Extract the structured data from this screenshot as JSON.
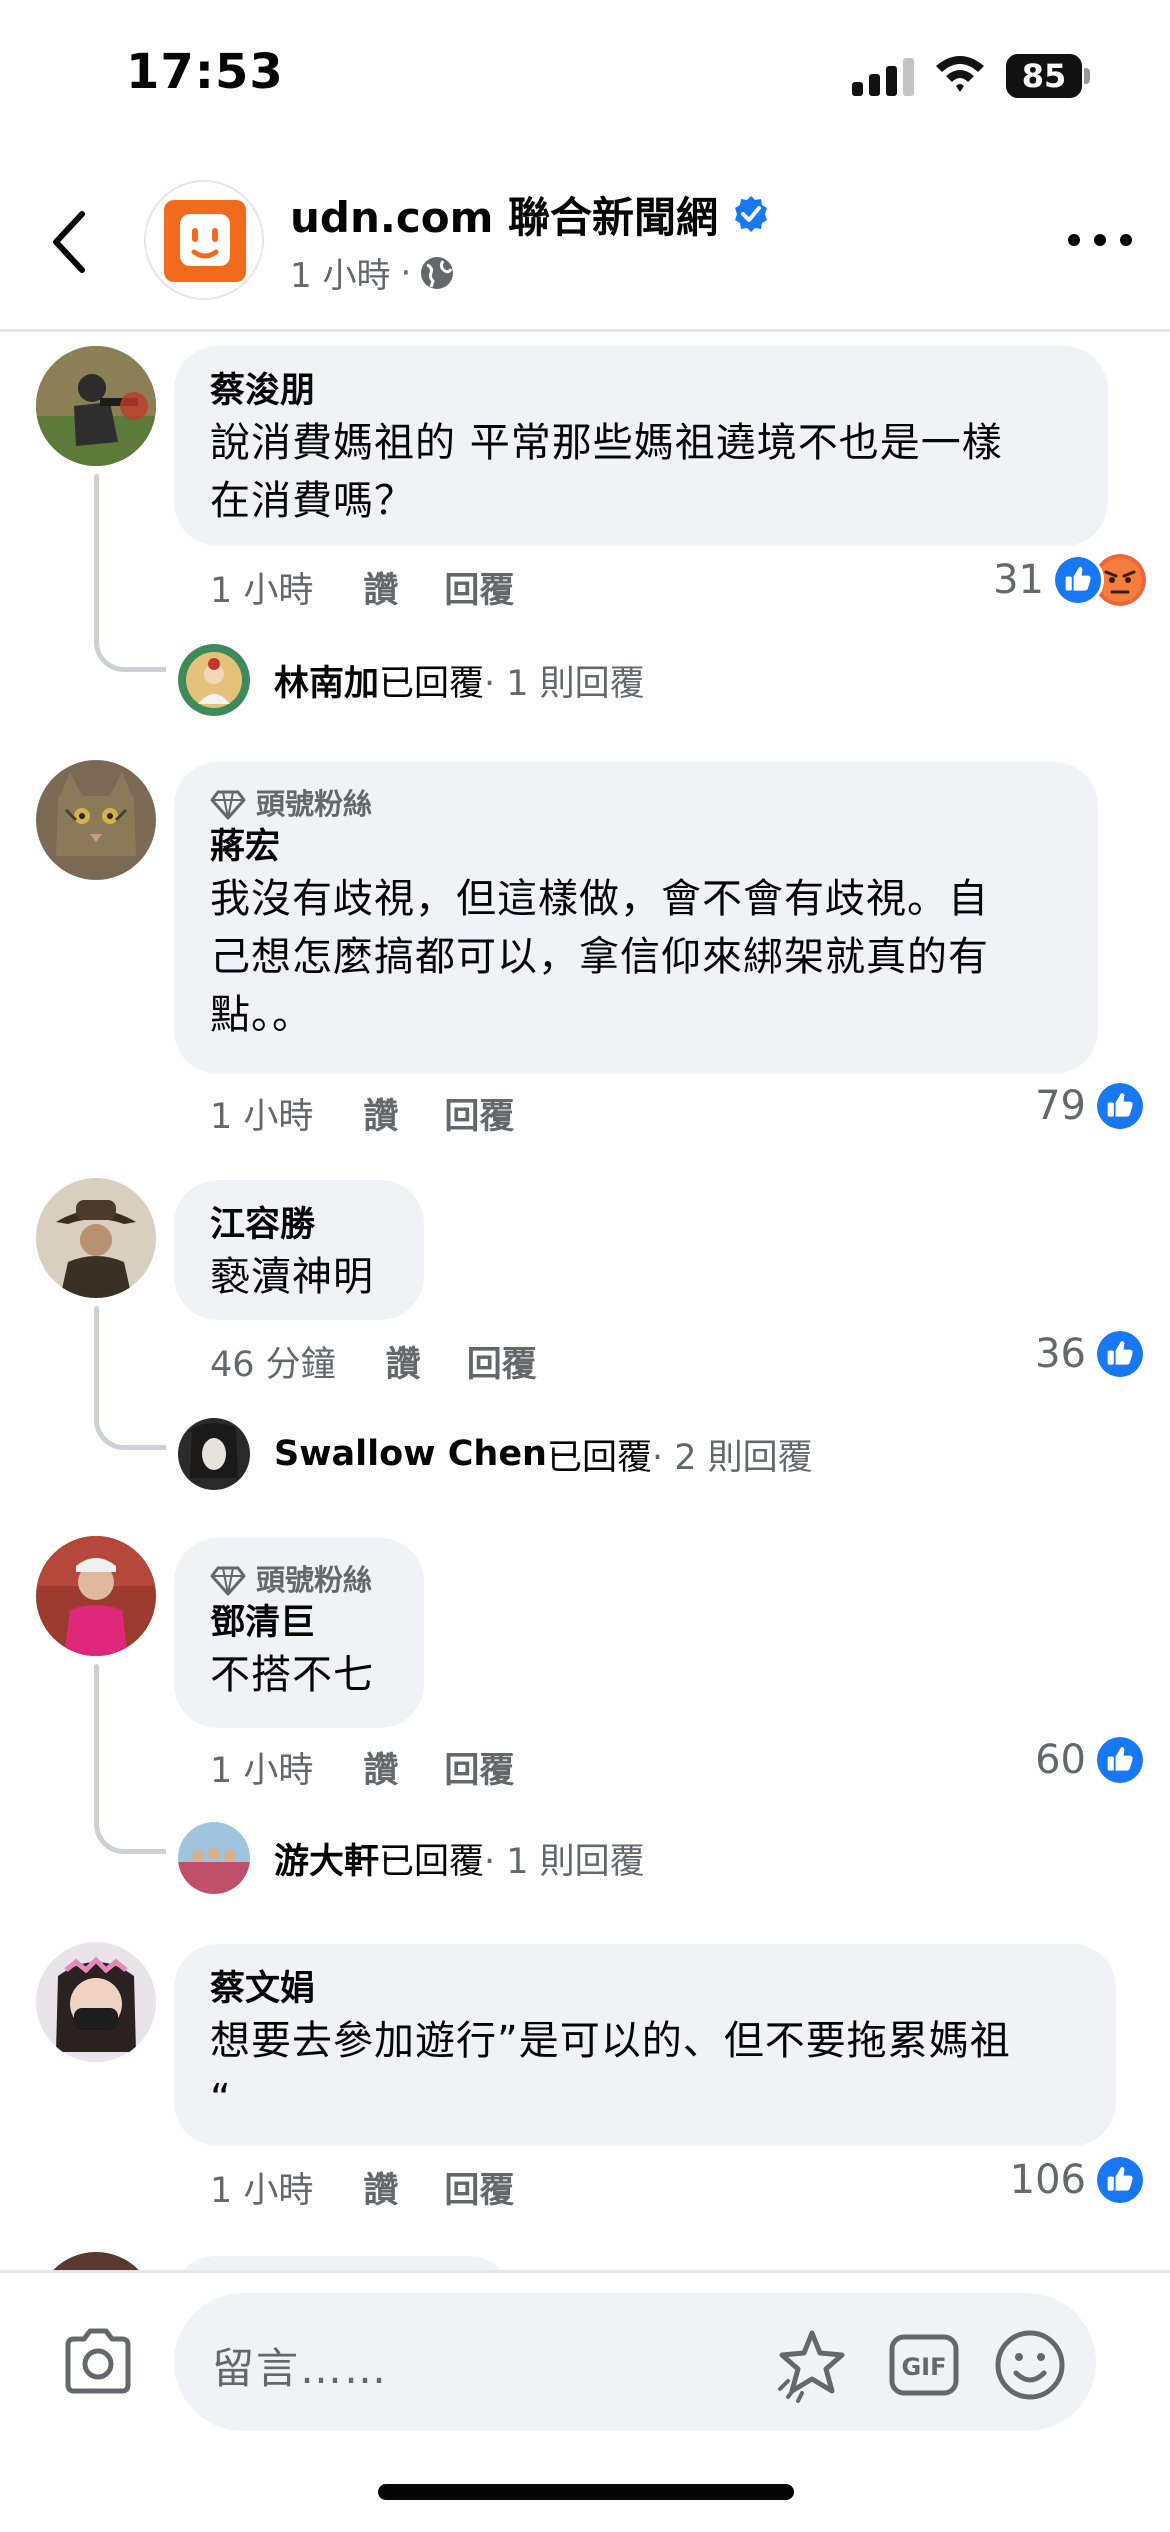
{
  "status_bar": {
    "time": "17:53",
    "battery": "85"
  },
  "header": {
    "page_name": "udn.com 聯合新聞網",
    "time": "1 小時",
    "separator": "·"
  },
  "comments": [
    {
      "author": "蔡浚朋",
      "badge": "",
      "lines": [
        "說消費媽祖的 平常那些媽祖遶境不也是一樣",
        "在消費嗎？"
      ],
      "time": "1 小時",
      "like_label": "讚",
      "reply_label": "回覆",
      "reaction_count": "31",
      "reactions": [
        "like-icon",
        "angry-icon"
      ],
      "reply_summary": {
        "name": "林南加",
        "text": "已回覆",
        "count": " · 1 則回覆"
      }
    },
    {
      "author": "蔣宏",
      "badge": "頭號粉絲",
      "lines": [
        "我沒有歧視，但這樣做，會不會有歧視。自",
        "己想怎麼搞都可以，拿信仰來綁架就真的有",
        "點。。"
      ],
      "time": "1 小時",
      "like_label": "讚",
      "reply_label": "回覆",
      "reaction_count": "79",
      "reactions": [
        "like-icon"
      ]
    },
    {
      "author": "江容勝",
      "badge": "",
      "lines": [
        "褻瀆神明"
      ],
      "time": "46 分鐘",
      "like_label": "讚",
      "reply_label": "回覆",
      "reaction_count": "36",
      "reactions": [
        "like-icon"
      ],
      "reply_summary": {
        "name": "Swallow Chen",
        "text": " 已回覆",
        "count": " · 2 則回覆"
      }
    },
    {
      "author": "鄧清巨",
      "badge": "頭號粉絲",
      "lines": [
        "不搭不七"
      ],
      "time": "1 小時",
      "like_label": "讚",
      "reply_label": "回覆",
      "reaction_count": "60",
      "reactions": [
        "like-icon"
      ],
      "reply_summary": {
        "name": "游大軒",
        "text": "已回覆",
        "count": " · 1 則回覆"
      }
    },
    {
      "author": "蔡文娟",
      "badge": "",
      "lines": [
        "想要去參加遊行”是可以的、但不要拖累媽祖",
        "“"
      ],
      "time": "1 小時",
      "like_label": "讚",
      "reply_label": "回覆",
      "reaction_count": "106",
      "reactions": [
        "like-icon"
      ]
    }
  ],
  "composer": {
    "placeholder": "留言……"
  },
  "colors": {
    "brand_blue": "#1877f2",
    "udn_orange": "#f26b1d",
    "bubble_gray": "#f0f2f5",
    "meta_gray": "#65676b"
  }
}
